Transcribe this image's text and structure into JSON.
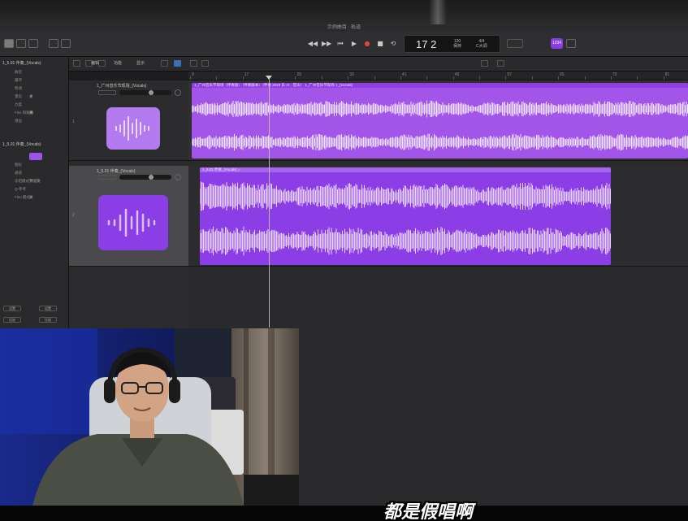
{
  "window": {
    "title": "示例曲目 · 轨道"
  },
  "transport": {
    "rewind_icon": "rewind-icon",
    "forward_icon": "fast-forward-icon",
    "to_start_icon": "skip-back-icon",
    "play_icon": "play-icon",
    "stop_icon": "stop-icon",
    "record_icon": "record-icon",
    "cycle_icon": "cycle-icon",
    "lcd": {
      "bar": "17",
      "beat": "2",
      "tempo": "120",
      "tempo_label": "保持",
      "time_sig": "4/4",
      "key": "C大调"
    },
    "master_label": "1234"
  },
  "inspector": {
    "region_title": "1_5.01 伴奏_(Vocals)",
    "track_title": "1_5.01 伴奏_(Vocals)",
    "region_rows": [
      {
        "label": "静音",
        "value": ""
      },
      {
        "label": "循环",
        "value": ""
      },
      {
        "label": "移调",
        "value": ""
      },
      {
        "label": "量化",
        "value": "关"
      },
      {
        "label": "力度",
        "value": ""
      },
      {
        "label": "Flex 和跟随",
        "value": "关"
      },
      {
        "label": "增益",
        "value": ""
      }
    ],
    "track_rows": [
      {
        "label": "图标",
        "value": ""
      },
      {
        "label": "通道",
        "value": ""
      },
      {
        "label": "冻结模式",
        "value": "预渲染"
      },
      {
        "label": "Q-参考",
        "value": ""
      },
      {
        "label": "Flex 模式",
        "value": "关"
      }
    ],
    "footer": [
      "设置",
      "设置",
      "比较",
      "比较"
    ]
  },
  "header": {
    "menus": [
      "编辑",
      "功能",
      "显示"
    ]
  },
  "ruler": {
    "bars": [
      "9",
      "",
      "17",
      "",
      "25",
      "",
      "33",
      "",
      "41",
      "",
      "49",
      "",
      "57",
      "",
      "65",
      "",
      "73",
      "",
      "81"
    ]
  },
  "tracks": [
    {
      "number": "1",
      "name": "1_广州音乐节现场_(Vocals)",
      "color": "#b37af0",
      "region_label": "1_广州音乐节现场（伴奏版）（伴奏版本）（伴奏 2023 乐 AI · 音乐） 1_广州音乐节现场 1_(Vocals)",
      "region_end_label": "1_广州音乐节现场 (Vocals)"
    },
    {
      "number": "2",
      "name": "1_5.01 伴奏_(Vocals)",
      "color": "#8c3ee6",
      "region_label": "1_5.01 伴奏_(Vocals) ♪",
      "region_end_label": "1_5.01 伴奏"
    }
  ],
  "webcam": {
    "subject": "presenter-with-headphones"
  },
  "caption": "都是假唱啊"
}
